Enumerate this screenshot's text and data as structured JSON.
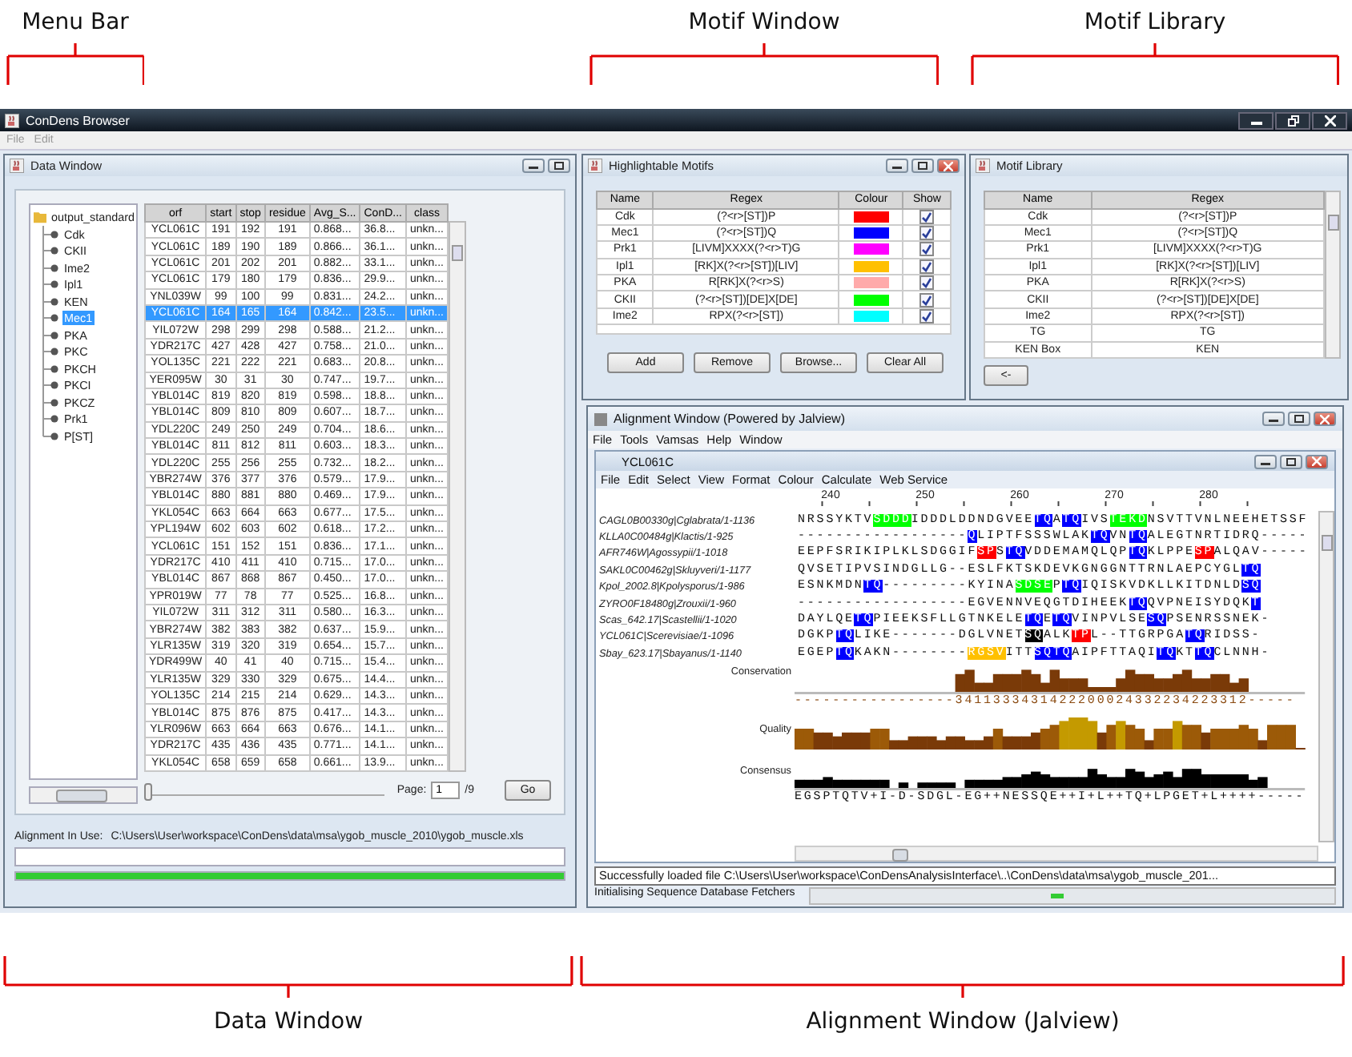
{
  "annotations_top": [
    {
      "label": "Menu Bar"
    },
    {
      "label": "Motif Window"
    },
    {
      "label": "Motif Library"
    }
  ],
  "window": {
    "title": "ConDens Browser",
    "menu": [
      {
        "label": "File",
        "disabled": true
      },
      {
        "label": "Edit",
        "disabled": true
      }
    ]
  },
  "data_window": {
    "title": "Data Window",
    "tree": {
      "label": "output_standard",
      "children": [
        {
          "label": "Cdk",
          "selected": false
        },
        {
          "label": "CKII",
          "selected": false
        },
        {
          "label": "Ime2",
          "selected": false
        },
        {
          "label": "Ipl1",
          "selected": false
        },
        {
          "label": "KEN",
          "selected": false
        },
        {
          "label": "Mec1",
          "selected": true
        },
        {
          "label": "PKA",
          "selected": false
        },
        {
          "label": "PKC",
          "selected": false
        },
        {
          "label": "PKCH",
          "selected": false
        },
        {
          "label": "PKCI",
          "selected": false
        },
        {
          "label": "PKCZ",
          "selected": false
        },
        {
          "label": "Prk1",
          "selected": false
        },
        {
          "label": "P[ST]",
          "selected": false
        }
      ]
    },
    "table": {
      "columns": [
        "orf",
        "start",
        "stop",
        "residue",
        "Avg_S...",
        "ConD...",
        "class"
      ],
      "rows": [
        {
          "cells": [
            "YCL061C",
            "191",
            "192",
            "191",
            "0.868...",
            "36.8...",
            "unkn..."
          ],
          "selected": false
        },
        {
          "cells": [
            "YCL061C",
            "189",
            "190",
            "189",
            "0.866...",
            "36.1...",
            "unkn..."
          ],
          "selected": false
        },
        {
          "cells": [
            "YCL061C",
            "201",
            "202",
            "201",
            "0.882...",
            "33.1...",
            "unkn..."
          ],
          "selected": false
        },
        {
          "cells": [
            "YCL061C",
            "179",
            "180",
            "179",
            "0.836...",
            "29.9...",
            "unkn..."
          ],
          "selected": false
        },
        {
          "cells": [
            "YNL039W",
            "99",
            "100",
            "99",
            "0.831...",
            "24.2...",
            "unkn..."
          ],
          "selected": false
        },
        {
          "cells": [
            "YCL061C",
            "164",
            "165",
            "164",
            "0.842...",
            "23.5...",
            "unkn..."
          ],
          "selected": true
        },
        {
          "cells": [
            "YIL072W",
            "298",
            "299",
            "298",
            "0.588...",
            "21.2...",
            "unkn..."
          ],
          "selected": false
        },
        {
          "cells": [
            "YDR217C",
            "427",
            "428",
            "427",
            "0.758...",
            "21.0...",
            "unkn..."
          ],
          "selected": false
        },
        {
          "cells": [
            "YOL135C",
            "221",
            "222",
            "221",
            "0.683...",
            "20.8...",
            "unkn..."
          ],
          "selected": false
        },
        {
          "cells": [
            "YER095W",
            "30",
            "31",
            "30",
            "0.747...",
            "19.7...",
            "unkn..."
          ],
          "selected": false
        },
        {
          "cells": [
            "YBL014C",
            "819",
            "820",
            "819",
            "0.598...",
            "18.8...",
            "unkn..."
          ],
          "selected": false
        },
        {
          "cells": [
            "YBL014C",
            "809",
            "810",
            "809",
            "0.607...",
            "18.7...",
            "unkn..."
          ],
          "selected": false
        },
        {
          "cells": [
            "YDL220C",
            "249",
            "250",
            "249",
            "0.704...",
            "18.6...",
            "unkn..."
          ],
          "selected": false
        },
        {
          "cells": [
            "YBL014C",
            "811",
            "812",
            "811",
            "0.603...",
            "18.3...",
            "unkn..."
          ],
          "selected": false
        },
        {
          "cells": [
            "YDL220C",
            "255",
            "256",
            "255",
            "0.732...",
            "18.2...",
            "unkn..."
          ],
          "selected": false
        },
        {
          "cells": [
            "YBR274W",
            "376",
            "377",
            "376",
            "0.579...",
            "17.9...",
            "unkn..."
          ],
          "selected": false
        },
        {
          "cells": [
            "YBL014C",
            "880",
            "881",
            "880",
            "0.469...",
            "17.9...",
            "unkn..."
          ],
          "selected": false
        },
        {
          "cells": [
            "YKL054C",
            "663",
            "664",
            "663",
            "0.677...",
            "17.5...",
            "unkn..."
          ],
          "selected": false
        },
        {
          "cells": [
            "YPL194W",
            "602",
            "603",
            "602",
            "0.618...",
            "17.2...",
            "unkn..."
          ],
          "selected": false
        },
        {
          "cells": [
            "YCL061C",
            "151",
            "152",
            "151",
            "0.836...",
            "17.1...",
            "unkn..."
          ],
          "selected": false
        },
        {
          "cells": [
            "YDR217C",
            "410",
            "411",
            "410",
            "0.715...",
            "17.0...",
            "unkn..."
          ],
          "selected": false
        },
        {
          "cells": [
            "YBL014C",
            "867",
            "868",
            "867",
            "0.450...",
            "17.0...",
            "unkn..."
          ],
          "selected": false
        },
        {
          "cells": [
            "YPR019W",
            "77",
            "78",
            "77",
            "0.525...",
            "16.8...",
            "unkn..."
          ],
          "selected": false
        },
        {
          "cells": [
            "YIL072W",
            "311",
            "312",
            "311",
            "0.580...",
            "16.3...",
            "unkn..."
          ],
          "selected": false
        },
        {
          "cells": [
            "YBR274W",
            "382",
            "383",
            "382",
            "0.637...",
            "15.9...",
            "unkn..."
          ],
          "selected": false
        },
        {
          "cells": [
            "YLR135W",
            "319",
            "320",
            "319",
            "0.654...",
            "15.7...",
            "unkn..."
          ],
          "selected": false
        },
        {
          "cells": [
            "YDR499W",
            "40",
            "41",
            "40",
            "0.715...",
            "15.4...",
            "unkn..."
          ],
          "selected": false
        },
        {
          "cells": [
            "YLR135W",
            "329",
            "330",
            "329",
            "0.675...",
            "14.4...",
            "unkn..."
          ],
          "selected": false
        },
        {
          "cells": [
            "YOL135C",
            "214",
            "215",
            "214",
            "0.629...",
            "14.3...",
            "unkn..."
          ],
          "selected": false
        },
        {
          "cells": [
            "YBL014C",
            "875",
            "876",
            "875",
            "0.417...",
            "14.3...",
            "unkn..."
          ],
          "selected": false
        },
        {
          "cells": [
            "YLR096W",
            "663",
            "664",
            "663",
            "0.676...",
            "14.1...",
            "unkn..."
          ],
          "selected": false
        },
        {
          "cells": [
            "YDR217C",
            "435",
            "436",
            "435",
            "0.771...",
            "14.1...",
            "unkn..."
          ],
          "selected": false
        },
        {
          "cells": [
            "YKL054C",
            "658",
            "659",
            "658",
            "0.661...",
            "13.9...",
            "unkn..."
          ],
          "selected": false
        }
      ]
    },
    "page_slider": {
      "level": 0
    },
    "page_label": "Page:",
    "page": "1",
    "page_total": "/9",
    "go_button": "Go",
    "alignment_label": "Alignment In Use:",
    "alignment_path": "C:\\Users\\User\\workspace\\ConDens\\data\\msa\\ygob_muscle_2010\\ygob_muscle.xls",
    "progress": {
      "level": 1
    }
  },
  "motif_window": {
    "title": "Highlightable Motifs",
    "columns": [
      "Name",
      "Regex",
      "Colour",
      "Show"
    ],
    "motifs": [
      {
        "name": "Cdk",
        "regex": "(?<r>[ST])P",
        "color": "#ff0000",
        "checked": true
      },
      {
        "name": "Mec1",
        "regex": "(?<r>[ST])Q",
        "color": "#0000ff",
        "checked": true
      },
      {
        "name": "Prk1",
        "regex": "[LIVM]XXXX(?<r>T)G",
        "color": "#ff00ff",
        "checked": true
      },
      {
        "name": "Ipl1",
        "regex": "[RK]X(?<r>[ST])[LIV]",
        "color": "#ffc000",
        "checked": true
      },
      {
        "name": "PKA",
        "regex": "R[RK]X(?<r>S)",
        "color": "#ffaaaa",
        "checked": true
      },
      {
        "name": "CKII",
        "regex": "(?<r>[ST])[DE]X[DE]",
        "color": "#00ff00",
        "checked": true
      },
      {
        "name": "Ime2",
        "regex": "RPX(?<r>[ST])",
        "color": "#00ffff",
        "checked": true
      }
    ],
    "buttons": [
      "Add",
      "Remove",
      "Browse...",
      "Clear All"
    ]
  },
  "motif_library": {
    "title": "Motif Library",
    "columns": [
      "Name",
      "Regex"
    ],
    "motifs": [
      {
        "name": "Cdk",
        "regex": "(?<r>[ST])P"
      },
      {
        "name": "Mec1",
        "regex": "(?<r>[ST])Q"
      },
      {
        "name": "Prk1",
        "regex": "[LIVM]XXXX(?<r>T)G"
      },
      {
        "name": "Ipl1",
        "regex": "[RK]X(?<r>[ST])[LIV]"
      },
      {
        "name": "PKA",
        "regex": "R[RK]X(?<r>S)"
      },
      {
        "name": "CKII",
        "regex": "(?<r>[ST])[DE]X[DE]"
      },
      {
        "name": "Ime2",
        "regex": "RPX(?<r>[ST])"
      },
      {
        "name": "TG",
        "regex": "TG"
      },
      {
        "name": "KEN Box",
        "regex": "KEN"
      }
    ],
    "add_button": "<-"
  },
  "alignment_window": {
    "title": "Alignment Window (Powered by Jalview)",
    "menu": [
      "File",
      "Tools",
      "Vamsas",
      "Help",
      "Window"
    ],
    "frame_title": "YCL061C",
    "frame_menu": [
      "File",
      "Edit",
      "Select",
      "View",
      "Format",
      "Colour",
      "Calculate",
      "Web Service"
    ],
    "ruler": [
      "240",
      "250",
      "260",
      "270",
      "280"
    ],
    "sequences": [
      {
        "name": "CAGL0B00330g|Cglabrata/1-1136",
        "segments": [
          {
            "text": "NRSSYKTV"
          },
          {
            "text": "SDDD",
            "color": "#00ff00"
          },
          {
            "text": "IDDDLDDNDGVEE"
          },
          {
            "text": "TQ",
            "color": "#0000ff"
          },
          {
            "text": "A"
          },
          {
            "text": "TQ",
            "color": "#0000ff"
          },
          {
            "text": "IVS"
          },
          {
            "text": "TEKD",
            "color": "#00ff00"
          },
          {
            "text": "NSVTTVNLNEEHETSSF"
          }
        ]
      },
      {
        "name": "KLLA0C00484g|Klactis/1-925",
        "segments": [
          {
            "text": "------------------"
          },
          {
            "text": "Q",
            "color": "#0000ff"
          },
          {
            "text": "LIPTFSSSWLAK"
          },
          {
            "text": "TQ",
            "color": "#0000ff"
          },
          {
            "text": "VN"
          },
          {
            "text": "TQ",
            "color": "#0000ff"
          },
          {
            "text": "ALEGTNRTIDRQ-----"
          }
        ]
      },
      {
        "name": "AFR746W|Agossypii/1-1018",
        "segments": [
          {
            "text": "EEPFSRIKIPLKLSDGGIF"
          },
          {
            "text": "SP",
            "color": "#ff0000"
          },
          {
            "text": "S"
          },
          {
            "text": "TQ",
            "color": "#0000ff"
          },
          {
            "text": "VDDEMAMQLQP"
          },
          {
            "text": "TQ",
            "color": "#0000ff"
          },
          {
            "text": "KLPPE"
          },
          {
            "text": "SP",
            "color": "#ff0000"
          },
          {
            "text": "ALQAV-----"
          }
        ]
      },
      {
        "name": "SAKL0C00462g|Skluyveri/1-1177",
        "segments": [
          {
            "text": "QVSETIPVSINDGLLG--ESLFKTSKDEVKGNGGNTTRNLAEPCYGL"
          },
          {
            "text": "TQ",
            "color": "#0000ff"
          }
        ]
      },
      {
        "name": "Kpol_2002.8|Kpolysporus/1-986",
        "segments": [
          {
            "text": "ESNKMDN"
          },
          {
            "text": "TQ",
            "color": "#0000ff"
          },
          {
            "text": "---------KYINA"
          },
          {
            "text": "SDSE",
            "color": "#00ff00"
          },
          {
            "text": "P"
          },
          {
            "text": "TQ",
            "color": "#0000ff"
          },
          {
            "text": "IQISKVDKLLKITDNLD"
          },
          {
            "text": "SQ",
            "color": "#0000ff"
          }
        ]
      },
      {
        "name": "ZYRO0F18480g|Zrouxii/1-960",
        "segments": [
          {
            "text": "------------------EGVENNVEQGTDIHEEK"
          },
          {
            "text": "TQ",
            "color": "#0000ff"
          },
          {
            "text": "QVPNEISYDQK"
          },
          {
            "text": "T",
            "color": "#0000ff"
          }
        ]
      },
      {
        "name": "Scas_642.17|Scastellii/1-1020",
        "segments": [
          {
            "text": "DAYLQE"
          },
          {
            "text": "TQ",
            "color": "#0000ff"
          },
          {
            "text": "PIEEKSFLLGTNKELE"
          },
          {
            "text": "TQ",
            "color": "#0000ff"
          },
          {
            "text": "E"
          },
          {
            "text": "TQ",
            "color": "#0000ff"
          },
          {
            "text": "VINPVLSE"
          },
          {
            "text": "SQ",
            "color": "#0000ff"
          },
          {
            "text": "PSENRSSNEK-"
          }
        ]
      },
      {
        "name": "YCL061C|Scerevisiae/1-1096",
        "segments": [
          {
            "text": "DGKP"
          },
          {
            "text": "TQ",
            "color": "#0000ff"
          },
          {
            "text": "LIKE-------DGLVNET"
          },
          {
            "text": "SQ",
            "color": "#000000"
          },
          {
            "text": "ALK"
          },
          {
            "text": "TP",
            "color": "#ff0000"
          },
          {
            "text": "L--TTGRPGA"
          },
          {
            "text": "TQ",
            "color": "#0000ff"
          },
          {
            "text": "RIDSS-"
          }
        ]
      },
      {
        "name": "Sbay_623.17|Sbayanus/1-1140",
        "segments": [
          {
            "text": "EGEP"
          },
          {
            "text": "TQ",
            "color": "#0000ff"
          },
          {
            "text": "KAKN--------"
          },
          {
            "text": "RGSV",
            "color": "#ffc000"
          },
          {
            "text": "ITT"
          },
          {
            "text": "SQTQ",
            "color": "#0000ff"
          },
          {
            "text": "AIPFTTAQI"
          },
          {
            "text": "TQ",
            "color": "#0000ff"
          },
          {
            "text": "KT"
          },
          {
            "text": "TQ",
            "color": "#0000ff"
          },
          {
            "text": "CLNNH-"
          }
        ]
      }
    ],
    "conservation_label": "Conservation",
    "conservation": "-----------------3411333431422200024332234223312-----",
    "quality_label": "Quality",
    "consensus_label": "Consensus",
    "consensus": "EGSPTQTV+I-D-SDGL-EG++NESSQE++I+L++TQ+LPGET+L++++-----",
    "status": "Successfully loaded file C:\\Users\\User\\workspace\\ConDensAnalysisInterface\\..\\ConDens\\data\\msa\\ygob_muscle_201...",
    "progress_label": "Initialising Sequence Database Fetchers"
  },
  "annotations_bottom": [
    {
      "label": "Data Window"
    },
    {
      "label": "Alignment Window (Jalview)"
    }
  ]
}
